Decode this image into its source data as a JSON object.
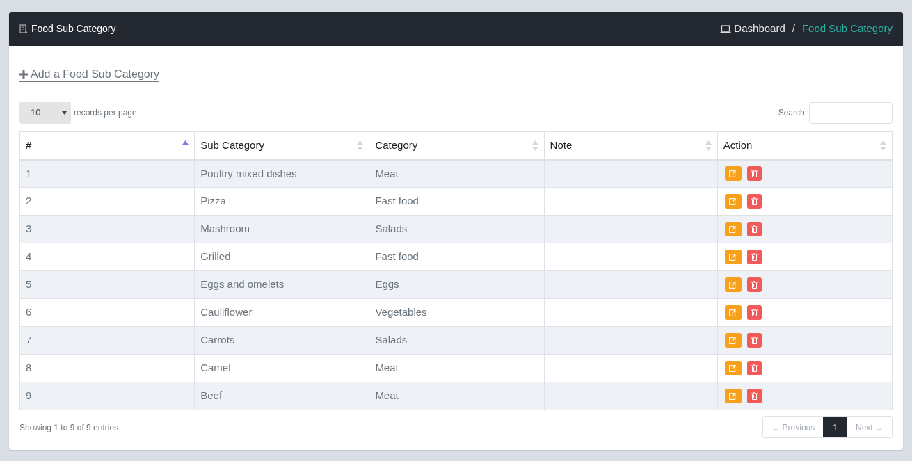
{
  "header": {
    "title": "Food Sub Category",
    "breadcrumb": [
      {
        "label": "Dashboard",
        "current": false
      },
      {
        "label": "Food Sub Category",
        "current": true
      }
    ],
    "separator": "/"
  },
  "add_link": "Add a Food Sub Category",
  "page_size": {
    "value": "10",
    "label": "records per page"
  },
  "search": {
    "label": "Search:"
  },
  "table": {
    "columns": [
      {
        "label": "#",
        "sorted": true
      },
      {
        "label": "Sub Category",
        "sorted": false
      },
      {
        "label": "Category",
        "sorted": false
      },
      {
        "label": "Note",
        "sorted": false
      },
      {
        "label": "Action",
        "sorted": false
      }
    ],
    "rows": [
      [
        "1",
        "Poultry mixed dishes",
        "Meat"
      ],
      [
        "2",
        "Pizza",
        "Fast food"
      ],
      [
        "3",
        "Mashroom",
        "Salads"
      ],
      [
        "4",
        "Grilled",
        "Fast food"
      ],
      [
        "5",
        "Eggs and omelets",
        "Eggs"
      ],
      [
        "6",
        "Cauliflower",
        "Vegetables"
      ],
      [
        "7",
        "Carrots",
        "Salads"
      ],
      [
        "8",
        "Camel",
        "Meat"
      ],
      [
        "9",
        "Beef",
        "Meat"
      ]
    ]
  },
  "footer": {
    "info": "Showing 1 to 9 of 9 entries",
    "pagination": [
      {
        "label": "← Previous",
        "selected": false,
        "disabled": true
      },
      {
        "label": "1",
        "selected": true,
        "disabled": false
      },
      {
        "label": "Next →",
        "selected": false,
        "disabled": true
      }
    ]
  }
}
